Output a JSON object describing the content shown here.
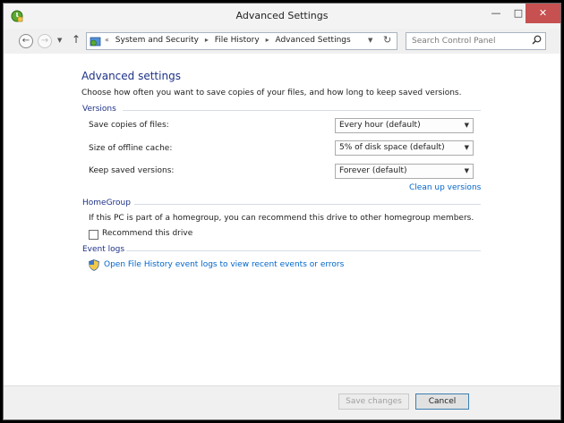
{
  "window": {
    "title": "Advanced Settings",
    "controls": {
      "minimize": "—",
      "maximize": "□",
      "close": "✕"
    }
  },
  "nav": {
    "back": "←",
    "forward": "→",
    "up": "↑",
    "overflow": "«",
    "breadcrumb": [
      "System and Security",
      "File History",
      "Advanced Settings"
    ],
    "search_placeholder": "Search Control Panel"
  },
  "main": {
    "title": "Advanced settings",
    "description": "Choose how often you want to save copies of your files, and how long to keep saved versions.",
    "versions": {
      "heading": "Versions",
      "rows": [
        {
          "label": "Save copies of files:",
          "value": "Every hour (default)"
        },
        {
          "label": "Size of offline cache:",
          "value": "5% of disk space (default)"
        },
        {
          "label": "Keep saved versions:",
          "value": "Forever (default)"
        }
      ],
      "cleanup_link": "Clean up versions"
    },
    "homegroup": {
      "heading": "HomeGroup",
      "text": "If this PC is part of a homegroup, you can recommend this drive to other homegroup members.",
      "checkbox_label": "Recommend this drive",
      "checked": false
    },
    "event_logs": {
      "heading": "Event logs",
      "link": "Open File History event logs to view recent events or errors"
    }
  },
  "footer": {
    "save_label": "Save changes",
    "cancel_label": "Cancel"
  },
  "colors": {
    "heading_blue": "#1e3287",
    "link_blue": "#0066cc",
    "close_red": "#c75050"
  },
  "icons": [
    "file-history-icon",
    "control-panel-icon",
    "shield-icon",
    "search-icon",
    "refresh-icon"
  ]
}
